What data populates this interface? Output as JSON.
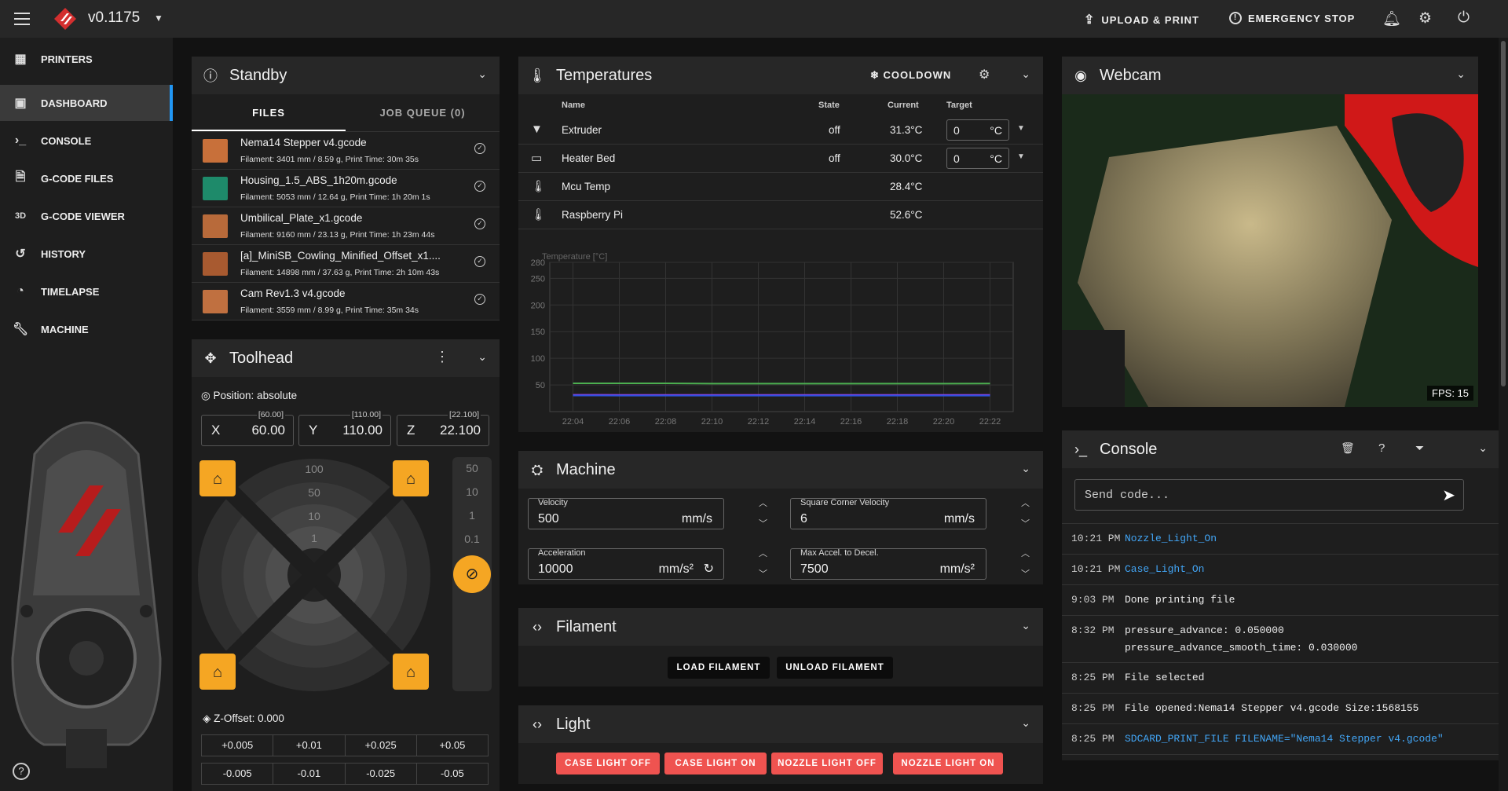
{
  "topbar": {
    "version": "v0.1175",
    "upload_label": "UPLOAD & PRINT",
    "estop_label": "EMERGENCY STOP"
  },
  "sidebar": {
    "items": [
      {
        "label": "PRINTERS",
        "icon": "grid-icon",
        "active": false
      },
      {
        "label": "DASHBOARD",
        "icon": "monitor-icon",
        "active": true
      },
      {
        "label": "CONSOLE",
        "icon": "console-icon",
        "active": false
      },
      {
        "label": "G-CODE FILES",
        "icon": "file-icon",
        "active": false
      },
      {
        "label": "G-CODE VIEWER",
        "icon": "3d-icon",
        "active": false
      },
      {
        "label": "HISTORY",
        "icon": "history-icon",
        "active": false
      },
      {
        "label": "TIMELAPSE",
        "icon": "timelapse-icon",
        "active": false
      },
      {
        "label": "MACHINE",
        "icon": "wrench-icon",
        "active": false
      }
    ],
    "help": "?"
  },
  "standby": {
    "title": "Standby",
    "tabs": [
      "FILES",
      "JOB QUEUE (0)"
    ],
    "files": [
      {
        "name": "Nema14 Stepper v4.gcode",
        "meta": "Filament: 3401 mm / 8.59 g, Print Time: 30m 35s",
        "color": "#c8703a"
      },
      {
        "name": "Housing_1.5_ABS_1h20m.gcode",
        "meta": "Filament: 5053 mm / 12.64 g, Print Time: 1h 20m 1s",
        "color": "#1e8a6a"
      },
      {
        "name": "Umbilical_Plate_x1.gcode",
        "meta": "Filament: 9160 mm / 23.13 g, Print Time: 1h 23m 44s",
        "color": "#b86a3a"
      },
      {
        "name": "[a]_MiniSB_Cowling_Minified_Offset_x1....",
        "meta": "Filament: 14898 mm / 37.63 g, Print Time: 2h 10m 43s",
        "color": "#a85a30"
      },
      {
        "name": "Cam Rev1.3 v4.gcode",
        "meta": "Filament: 3559 mm / 8.99 g, Print Time: 35m 34s",
        "color": "#c07040"
      }
    ]
  },
  "toolhead": {
    "title": "Toolhead",
    "position_label": "Position: absolute",
    "axes": [
      {
        "label": "X",
        "value": "60.00",
        "bracket": "[60.00]"
      },
      {
        "label": "Y",
        "value": "110.00",
        "bracket": "[110.00]"
      },
      {
        "label": "Z",
        "value": "22.100",
        "bracket": "[22.100]"
      }
    ],
    "xy_steps": [
      "100",
      "50",
      "10",
      "1"
    ],
    "z_steps": [
      "50",
      "10",
      "1",
      "0.1"
    ],
    "zoffset_label": "Z-Offset: 0.000",
    "zoffset_up": [
      "+0.005",
      "+0.01",
      "+0.025",
      "+0.05"
    ],
    "zoffset_down": [
      "-0.005",
      "-0.01",
      "-0.025",
      "-0.05"
    ]
  },
  "temperatures": {
    "title": "Temperatures",
    "cooldown_label": "COOLDOWN",
    "headers": {
      "name": "Name",
      "state": "State",
      "current": "Current",
      "target": "Target"
    },
    "rows": [
      {
        "name": "Extruder",
        "state": "off",
        "current": "31.3°C",
        "target": "0",
        "unit": "°C",
        "icon": "extruder-icon"
      },
      {
        "name": "Heater Bed",
        "state": "off",
        "current": "30.0°C",
        "target": "0",
        "unit": "°C",
        "icon": "heater-bed-icon"
      },
      {
        "name": "Mcu Temp",
        "state": "",
        "current": "28.4°C",
        "icon": "thermometer-icon"
      },
      {
        "name": "Raspberry Pi",
        "state": "",
        "current": "52.6°C",
        "icon": "thermometer-icon"
      }
    ]
  },
  "chart_data": {
    "type": "line",
    "title": "",
    "ylabel": "Temperature [°C]",
    "ylim": [
      0,
      280
    ],
    "yticks": [
      "280",
      "250",
      "200",
      "150",
      "100",
      "50"
    ],
    "x": [
      "22:04",
      "22:06",
      "22:08",
      "22:10",
      "22:12",
      "22:14",
      "22:16",
      "22:18",
      "22:20",
      "22:22"
    ],
    "series": [
      {
        "name": "Raspberry Pi",
        "color": "#4caf50",
        "values": [
          53,
          53,
          53,
          52.5,
          52.5,
          52.5,
          52.5,
          52.5,
          52.5,
          52.6
        ]
      },
      {
        "name": "Extruder",
        "color": "#a040e0",
        "values": [
          31.5,
          31.4,
          31.4,
          31.3,
          31.3,
          31.3,
          31.3,
          31.3,
          31.3,
          31.3
        ]
      },
      {
        "name": "Heater Bed",
        "color": "#3050e0",
        "values": [
          30.2,
          30.1,
          30,
          30,
          30,
          30,
          30,
          30,
          30,
          30
        ]
      }
    ],
    "grid": true
  },
  "machine": {
    "title": "Machine",
    "fields": [
      {
        "label": "Velocity",
        "value": "500",
        "unit": "mm/s"
      },
      {
        "label": "Square Corner Velocity",
        "value": "6",
        "unit": "mm/s"
      },
      {
        "label": "Acceleration",
        "value": "10000",
        "unit": "mm/s²"
      },
      {
        "label": "Max Accel. to Decel.",
        "value": "7500",
        "unit": "mm/s²"
      }
    ]
  },
  "filament": {
    "title": "Filament",
    "load": "LOAD FILAMENT",
    "unload": "UNLOAD FILAMENT"
  },
  "light": {
    "title": "Light",
    "buttons": [
      "CASE LIGHT OFF",
      "CASE LIGHT ON",
      "NOZZLE LIGHT OFF",
      "NOZZLE LIGHT ON"
    ]
  },
  "webcam": {
    "title": "Webcam",
    "fps": "FPS: 15"
  },
  "console": {
    "title": "Console",
    "placeholder": "Send code...",
    "help": "?",
    "lines": [
      {
        "time": "10:21 PM",
        "msg": "Nozzle_Light_On",
        "link": true
      },
      {
        "time": "10:21 PM",
        "msg": "Case_Light_On",
        "link": true
      },
      {
        "time": "9:03 PM",
        "msg": "Done printing file",
        "link": false
      },
      {
        "time": "8:32 PM",
        "msg": "pressure_advance: 0.050000\npressure_advance_smooth_time: 0.030000",
        "link": false
      },
      {
        "time": "8:25 PM",
        "msg": "File selected",
        "link": false
      },
      {
        "time": "8:25 PM",
        "msg": "File opened:Nema14 Stepper v4.gcode Size:1568155",
        "link": false
      },
      {
        "time": "8:25 PM",
        "msg": "SDCARD_PRINT_FILE FILENAME=\"Nema14 Stepper v4.gcode\"",
        "link": true
      }
    ]
  }
}
